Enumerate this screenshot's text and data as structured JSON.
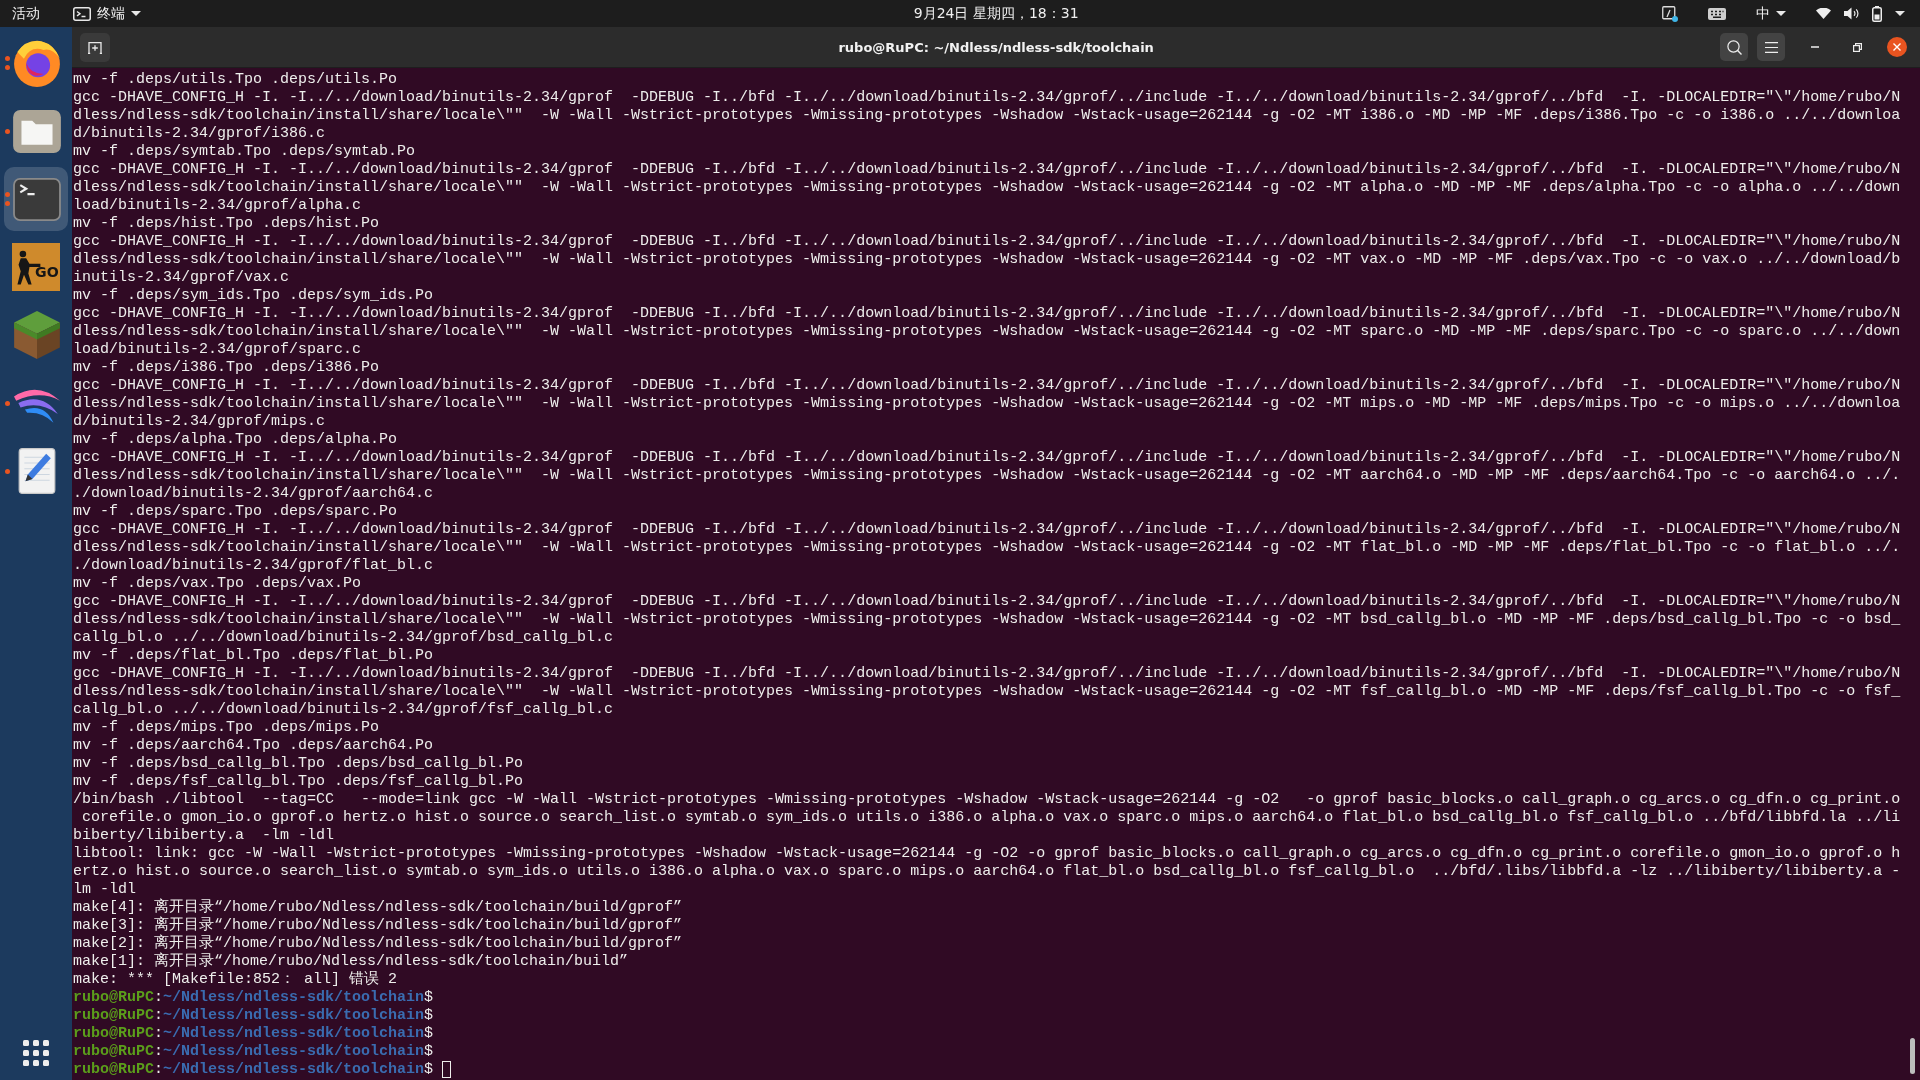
{
  "top_bar": {
    "activities": "活动",
    "app_menu": "终端",
    "clock": "9月24日 星期四，18：31",
    "input_method": "中"
  },
  "dock": {
    "items": [
      {
        "kind": "browser",
        "running": true,
        "multiple_windows": true,
        "selected": false
      },
      {
        "kind": "files",
        "running": true,
        "multiple_windows": false,
        "selected": false
      },
      {
        "kind": "terminal",
        "running": true,
        "multiple_windows": true,
        "selected": true
      },
      {
        "kind": "shooter",
        "logo_text": "GO",
        "running": false,
        "selected": false
      },
      {
        "kind": "blocks",
        "running": false,
        "selected": false
      },
      {
        "kind": "swoosh",
        "running": true,
        "multiple_windows": false,
        "selected": false
      },
      {
        "kind": "editor",
        "running": true,
        "multiple_windows": false,
        "selected": false
      }
    ]
  },
  "window": {
    "title": "rubo@RuPC: ~/Ndless/ndless-sdk/toolchain",
    "maximized": true
  },
  "terminal": {
    "lines": [
      {
        "kind": "output",
        "text": "mv -f .deps/utils.Tpo .deps/utils.Po"
      },
      {
        "kind": "output",
        "text": "gcc -DHAVE_CONFIG_H -I. -I../../download/binutils-2.34/gprof  -DDEBUG -I../bfd -I../../download/binutils-2.34/gprof/../include -I../../download/binutils-2.34/gprof/../bfd  -I. -DLOCALEDIR=\"\\\"/home/rubo/N"
      },
      {
        "kind": "output",
        "text": "dless/ndless-sdk/toolchain/install/share/locale\\\"\"  -W -Wall -Wstrict-prototypes -Wmissing-prototypes -Wshadow -Wstack-usage=262144 -g -O2 -MT i386.o -MD -MP -MF .deps/i386.Tpo -c -o i386.o ../../downloa"
      },
      {
        "kind": "output",
        "text": "d/binutils-2.34/gprof/i386.c"
      },
      {
        "kind": "output",
        "text": "mv -f .deps/symtab.Tpo .deps/symtab.Po"
      },
      {
        "kind": "output",
        "text": "gcc -DHAVE_CONFIG_H -I. -I../../download/binutils-2.34/gprof  -DDEBUG -I../bfd -I../../download/binutils-2.34/gprof/../include -I../../download/binutils-2.34/gprof/../bfd  -I. -DLOCALEDIR=\"\\\"/home/rubo/N"
      },
      {
        "kind": "output",
        "text": "dless/ndless-sdk/toolchain/install/share/locale\\\"\"  -W -Wall -Wstrict-prototypes -Wmissing-prototypes -Wshadow -Wstack-usage=262144 -g -O2 -MT alpha.o -MD -MP -MF .deps/alpha.Tpo -c -o alpha.o ../../down"
      },
      {
        "kind": "output",
        "text": "load/binutils-2.34/gprof/alpha.c"
      },
      {
        "kind": "output",
        "text": "mv -f .deps/hist.Tpo .deps/hist.Po"
      },
      {
        "kind": "output",
        "text": "gcc -DHAVE_CONFIG_H -I. -I../../download/binutils-2.34/gprof  -DDEBUG -I../bfd -I../../download/binutils-2.34/gprof/../include -I../../download/binutils-2.34/gprof/../bfd  -I. -DLOCALEDIR=\"\\\"/home/rubo/N"
      },
      {
        "kind": "output",
        "text": "dless/ndless-sdk/toolchain/install/share/locale\\\"\"  -W -Wall -Wstrict-prototypes -Wmissing-prototypes -Wshadow -Wstack-usage=262144 -g -O2 -MT vax.o -MD -MP -MF .deps/vax.Tpo -c -o vax.o ../../download/b"
      },
      {
        "kind": "output",
        "text": "inutils-2.34/gprof/vax.c"
      },
      {
        "kind": "output",
        "text": "mv -f .deps/sym_ids.Tpo .deps/sym_ids.Po"
      },
      {
        "kind": "output",
        "text": "gcc -DHAVE_CONFIG_H -I. -I../../download/binutils-2.34/gprof  -DDEBUG -I../bfd -I../../download/binutils-2.34/gprof/../include -I../../download/binutils-2.34/gprof/../bfd  -I. -DLOCALEDIR=\"\\\"/home/rubo/N"
      },
      {
        "kind": "output",
        "text": "dless/ndless-sdk/toolchain/install/share/locale\\\"\"  -W -Wall -Wstrict-prototypes -Wmissing-prototypes -Wshadow -Wstack-usage=262144 -g -O2 -MT sparc.o -MD -MP -MF .deps/sparc.Tpo -c -o sparc.o ../../down"
      },
      {
        "kind": "output",
        "text": "load/binutils-2.34/gprof/sparc.c"
      },
      {
        "kind": "output",
        "text": "mv -f .deps/i386.Tpo .deps/i386.Po"
      },
      {
        "kind": "output",
        "text": "gcc -DHAVE_CONFIG_H -I. -I../../download/binutils-2.34/gprof  -DDEBUG -I../bfd -I../../download/binutils-2.34/gprof/../include -I../../download/binutils-2.34/gprof/../bfd  -I. -DLOCALEDIR=\"\\\"/home/rubo/N"
      },
      {
        "kind": "output",
        "text": "dless/ndless-sdk/toolchain/install/share/locale\\\"\"  -W -Wall -Wstrict-prototypes -Wmissing-prototypes -Wshadow -Wstack-usage=262144 -g -O2 -MT mips.o -MD -MP -MF .deps/mips.Tpo -c -o mips.o ../../downloa"
      },
      {
        "kind": "output",
        "text": "d/binutils-2.34/gprof/mips.c"
      },
      {
        "kind": "output",
        "text": "mv -f .deps/alpha.Tpo .deps/alpha.Po"
      },
      {
        "kind": "output",
        "text": "gcc -DHAVE_CONFIG_H -I. -I../../download/binutils-2.34/gprof  -DDEBUG -I../bfd -I../../download/binutils-2.34/gprof/../include -I../../download/binutils-2.34/gprof/../bfd  -I. -DLOCALEDIR=\"\\\"/home/rubo/N"
      },
      {
        "kind": "output",
        "text": "dless/ndless-sdk/toolchain/install/share/locale\\\"\"  -W -Wall -Wstrict-prototypes -Wmissing-prototypes -Wshadow -Wstack-usage=262144 -g -O2 -MT aarch64.o -MD -MP -MF .deps/aarch64.Tpo -c -o aarch64.o ../."
      },
      {
        "kind": "output",
        "text": "./download/binutils-2.34/gprof/aarch64.c"
      },
      {
        "kind": "output",
        "text": "mv -f .deps/sparc.Tpo .deps/sparc.Po"
      },
      {
        "kind": "output",
        "text": "gcc -DHAVE_CONFIG_H -I. -I../../download/binutils-2.34/gprof  -DDEBUG -I../bfd -I../../download/binutils-2.34/gprof/../include -I../../download/binutils-2.34/gprof/../bfd  -I. -DLOCALEDIR=\"\\\"/home/rubo/N"
      },
      {
        "kind": "output",
        "text": "dless/ndless-sdk/toolchain/install/share/locale\\\"\"  -W -Wall -Wstrict-prototypes -Wmissing-prototypes -Wshadow -Wstack-usage=262144 -g -O2 -MT flat_bl.o -MD -MP -MF .deps/flat_bl.Tpo -c -o flat_bl.o ../."
      },
      {
        "kind": "output",
        "text": "./download/binutils-2.34/gprof/flat_bl.c"
      },
      {
        "kind": "output",
        "text": "mv -f .deps/vax.Tpo .deps/vax.Po"
      },
      {
        "kind": "output",
        "text": "gcc -DHAVE_CONFIG_H -I. -I../../download/binutils-2.34/gprof  -DDEBUG -I../bfd -I../../download/binutils-2.34/gprof/../include -I../../download/binutils-2.34/gprof/../bfd  -I. -DLOCALEDIR=\"\\\"/home/rubo/N"
      },
      {
        "kind": "output",
        "text": "dless/ndless-sdk/toolchain/install/share/locale\\\"\"  -W -Wall -Wstrict-prototypes -Wmissing-prototypes -Wshadow -Wstack-usage=262144 -g -O2 -MT bsd_callg_bl.o -MD -MP -MF .deps/bsd_callg_bl.Tpo -c -o bsd_"
      },
      {
        "kind": "output",
        "text": "callg_bl.o ../../download/binutils-2.34/gprof/bsd_callg_bl.c"
      },
      {
        "kind": "output",
        "text": "mv -f .deps/flat_bl.Tpo .deps/flat_bl.Po"
      },
      {
        "kind": "output",
        "text": "gcc -DHAVE_CONFIG_H -I. -I../../download/binutils-2.34/gprof  -DDEBUG -I../bfd -I../../download/binutils-2.34/gprof/../include -I../../download/binutils-2.34/gprof/../bfd  -I. -DLOCALEDIR=\"\\\"/home/rubo/N"
      },
      {
        "kind": "output",
        "text": "dless/ndless-sdk/toolchain/install/share/locale\\\"\"  -W -Wall -Wstrict-prototypes -Wmissing-prototypes -Wshadow -Wstack-usage=262144 -g -O2 -MT fsf_callg_bl.o -MD -MP -MF .deps/fsf_callg_bl.Tpo -c -o fsf_"
      },
      {
        "kind": "output",
        "text": "callg_bl.o ../../download/binutils-2.34/gprof/fsf_callg_bl.c"
      },
      {
        "kind": "output",
        "text": "mv -f .deps/mips.Tpo .deps/mips.Po"
      },
      {
        "kind": "output",
        "text": "mv -f .deps/aarch64.Tpo .deps/aarch64.Po"
      },
      {
        "kind": "output",
        "text": "mv -f .deps/bsd_callg_bl.Tpo .deps/bsd_callg_bl.Po"
      },
      {
        "kind": "output",
        "text": "mv -f .deps/fsf_callg_bl.Tpo .deps/fsf_callg_bl.Po"
      },
      {
        "kind": "output",
        "text": "/bin/bash ./libtool  --tag=CC   --mode=link gcc -W -Wall -Wstrict-prototypes -Wmissing-prototypes -Wshadow -Wstack-usage=262144 -g -O2   -o gprof basic_blocks.o call_graph.o cg_arcs.o cg_dfn.o cg_print.o"
      },
      {
        "kind": "output",
        "text": " corefile.o gmon_io.o gprof.o hertz.o hist.o source.o search_list.o symtab.o sym_ids.o utils.o i386.o alpha.o vax.o sparc.o mips.o aarch64.o flat_bl.o bsd_callg_bl.o fsf_callg_bl.o ../bfd/libbfd.la ../li"
      },
      {
        "kind": "output",
        "text": "biberty/libiberty.a  -lm -ldl"
      },
      {
        "kind": "output",
        "text": "libtool: link: gcc -W -Wall -Wstrict-prototypes -Wmissing-prototypes -Wshadow -Wstack-usage=262144 -g -O2 -o gprof basic_blocks.o call_graph.o cg_arcs.o cg_dfn.o cg_print.o corefile.o gmon_io.o gprof.o h"
      },
      {
        "kind": "output",
        "text": "ertz.o hist.o source.o search_list.o symtab.o sym_ids.o utils.o i386.o alpha.o vax.o sparc.o mips.o aarch64.o flat_bl.o bsd_callg_bl.o fsf_callg_bl.o  ../bfd/.libs/libbfd.a -lz ../libiberty/libiberty.a -"
      },
      {
        "kind": "output",
        "text": "lm -ldl"
      },
      {
        "kind": "output",
        "text": "make[4]: 离开目录“/home/rubo/Ndless/ndless-sdk/toolchain/build/gprof”"
      },
      {
        "kind": "output",
        "text": "make[3]: 离开目录“/home/rubo/Ndless/ndless-sdk/toolchain/build/gprof”"
      },
      {
        "kind": "output",
        "text": "make[2]: 离开目录“/home/rubo/Ndless/ndless-sdk/toolchain/build/gprof”"
      },
      {
        "kind": "output",
        "text": "make[1]: 离开目录“/home/rubo/Ndless/ndless-sdk/toolchain/build”"
      },
      {
        "kind": "output",
        "text": "make: *** [Makefile:852： all] 错误 2"
      },
      {
        "kind": "prompt",
        "user_host": "rubo@RuPC",
        "separator": ":",
        "path": "~/Ndless/ndless-sdk/toolchain",
        "symbol": "$",
        "cursor": false
      },
      {
        "kind": "prompt",
        "user_host": "rubo@RuPC",
        "separator": ":",
        "path": "~/Ndless/ndless-sdk/toolchain",
        "symbol": "$",
        "cursor": false
      },
      {
        "kind": "prompt",
        "user_host": "rubo@RuPC",
        "separator": ":",
        "path": "~/Ndless/ndless-sdk/toolchain",
        "symbol": "$",
        "cursor": false
      },
      {
        "kind": "prompt",
        "user_host": "rubo@RuPC",
        "separator": ":",
        "path": "~/Ndless/ndless-sdk/toolchain",
        "symbol": "$",
        "cursor": false
      },
      {
        "kind": "prompt",
        "user_host": "rubo@RuPC",
        "separator": ":",
        "path": "~/Ndless/ndless-sdk/toolchain",
        "symbol": "$",
        "cursor": true
      }
    ]
  }
}
